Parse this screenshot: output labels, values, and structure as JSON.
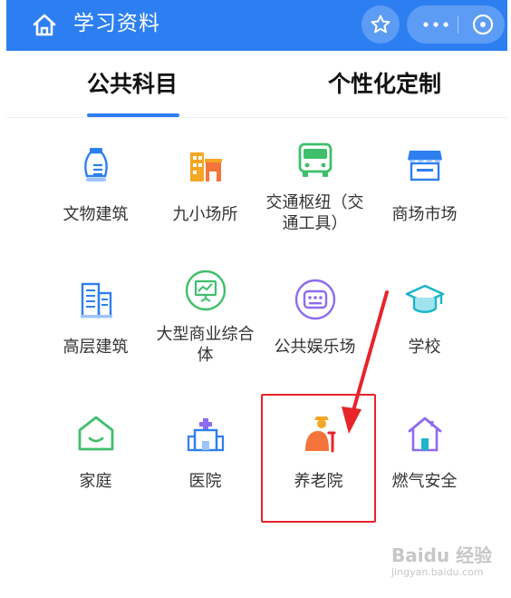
{
  "header": {
    "title": "学习资料"
  },
  "tabs": [
    {
      "label": "公共科目",
      "active": true
    },
    {
      "label": "个性化定制",
      "active": false
    }
  ],
  "grid": {
    "items": [
      {
        "label": "文物建筑",
        "icon": "vase-icon"
      },
      {
        "label": "九小场所",
        "icon": "shop-building-icon"
      },
      {
        "label": "交通枢纽（交通工具）",
        "icon": "bus-icon"
      },
      {
        "label": "商场市场",
        "icon": "storefront-icon"
      },
      {
        "label": "高层建筑",
        "icon": "tall-building-icon"
      },
      {
        "label": "大型商业综合体",
        "icon": "presentation-board-icon"
      },
      {
        "label": "公共娱乐场",
        "icon": "entertainment-icon"
      },
      {
        "label": "学校",
        "icon": "graduation-cap-icon"
      },
      {
        "label": "家庭",
        "icon": "home-smile-icon"
      },
      {
        "label": "医院",
        "icon": "hospital-icon"
      },
      {
        "label": "养老院",
        "icon": "elderly-person-icon"
      },
      {
        "label": "燃气安全",
        "icon": "gas-house-icon"
      }
    ]
  },
  "annotation": {
    "highlight_color": "#e8232a"
  },
  "watermark": {
    "logo": "Baidu 经验",
    "url": "jingyan.baidu.com"
  },
  "colors": {
    "header_bg": "#2d7ff1",
    "accent": "#2d7ff1",
    "annotation": "#e8232a"
  }
}
